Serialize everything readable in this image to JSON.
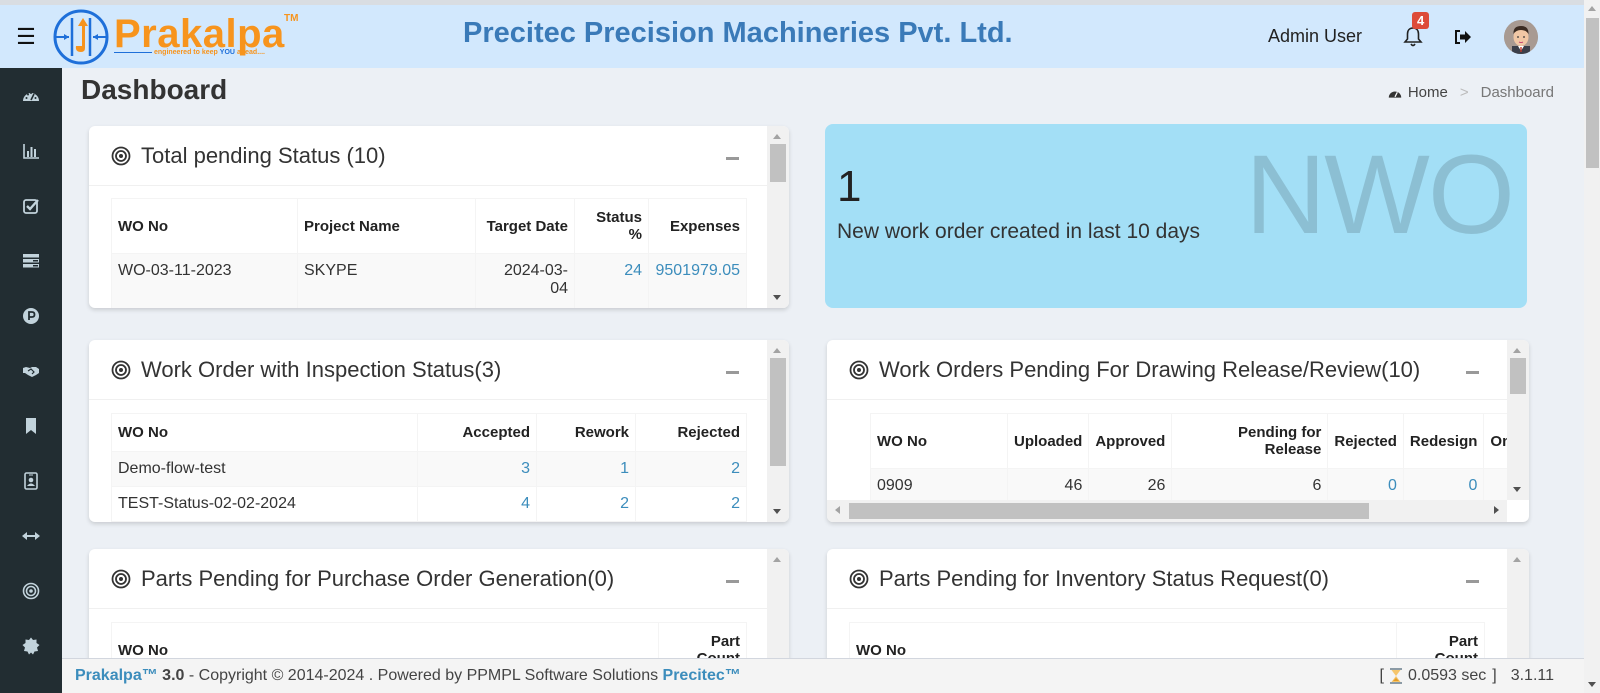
{
  "header": {
    "menu_icon": "hamburger-icon",
    "logo_word": "Prakalpa",
    "logo_tm": "TM",
    "logo_tagline_1": "engineered to keep",
    "logo_tagline_you": "YOU",
    "logo_tagline_2": "ahead....",
    "company_name": "Precitec Precision Machineries Pvt. Ltd.",
    "user_name": "Admin User",
    "notification_count": "4",
    "notification_icon": "bell-icon",
    "logout_icon": "sign-out-icon",
    "avatar_icon": "user-avatar"
  },
  "sidebar": {
    "items": [
      {
        "name": "dashboard",
        "icon": "tachometer-icon"
      },
      {
        "name": "reports",
        "icon": "bar-chart-icon"
      },
      {
        "name": "tasks",
        "icon": "check-square-icon"
      },
      {
        "name": "list",
        "icon": "tasks-icon"
      },
      {
        "name": "parking",
        "icon": "product-p-icon"
      },
      {
        "name": "handshake",
        "icon": "handshake-icon"
      },
      {
        "name": "bookmark",
        "icon": "bookmark-icon"
      },
      {
        "name": "id-badge",
        "icon": "id-badge-icon"
      },
      {
        "name": "arrows",
        "icon": "arrows-h-icon"
      },
      {
        "name": "bullseye",
        "icon": "bullseye-icon"
      },
      {
        "name": "certificate",
        "icon": "certificate-icon"
      }
    ]
  },
  "page": {
    "title": "Dashboard",
    "breadcrumb": {
      "home": "Home",
      "separator": ">",
      "current": "Dashboard"
    }
  },
  "pending_status": {
    "title": "Total pending Status (10)",
    "columns": [
      "WO No",
      "Project Name",
      "Target Date",
      "Status %",
      "Expenses"
    ],
    "rows": [
      {
        "wo_no": "WO-03-11-2023",
        "project": "SKYPE",
        "target_date_1": "2024-03-",
        "target_date_2": "04",
        "status": "24",
        "expenses": "9501979.05"
      }
    ]
  },
  "new_work_order": {
    "count": "1",
    "text": "New work order created in last 10 days",
    "watermark": "NWO"
  },
  "inspection_status": {
    "title": "Work Order with Inspection Status(3)",
    "columns": [
      "WO No",
      "Accepted",
      "Rework",
      "Rejected"
    ],
    "rows": [
      {
        "wo_no": "Demo-flow-test",
        "accepted": "3",
        "rework": "1",
        "rejected": "2"
      },
      {
        "wo_no": "TEST-Status-02-02-2024",
        "accepted": "4",
        "rework": "2",
        "rejected": "2"
      }
    ]
  },
  "drawing_release": {
    "title": "Work Orders Pending For Drawing Release/Review(10)",
    "columns": [
      "WO No",
      "Uploaded",
      "Approved",
      "Pending for Release",
      "Rejected",
      "Redesign",
      "On-Ho"
    ],
    "rows": [
      {
        "wo_no": "0909",
        "uploaded": "46",
        "approved": "26",
        "pending": "6",
        "rejected": "0",
        "redesign": "0",
        "onhold": ""
      }
    ]
  },
  "purchase_order": {
    "title": "Parts Pending for Purchase Order Generation(0)",
    "columns": [
      "WO No",
      "Part Count"
    ]
  },
  "inventory_status": {
    "title": "Parts Pending for Inventory Status Request(0)",
    "columns": [
      "WO No",
      "Part Count"
    ]
  },
  "footer": {
    "brand": "Prakalpa™",
    "version": "3.0",
    "copyright": " - Copyright © 2014-2024 . Powered by PPMPL Software Solutions ",
    "company": "Precitec™",
    "timer_open": "[",
    "timer_icon": "hourglass-icon",
    "time": "0.0593 sec",
    "timer_close": "]",
    "build": "3.1.11"
  }
}
